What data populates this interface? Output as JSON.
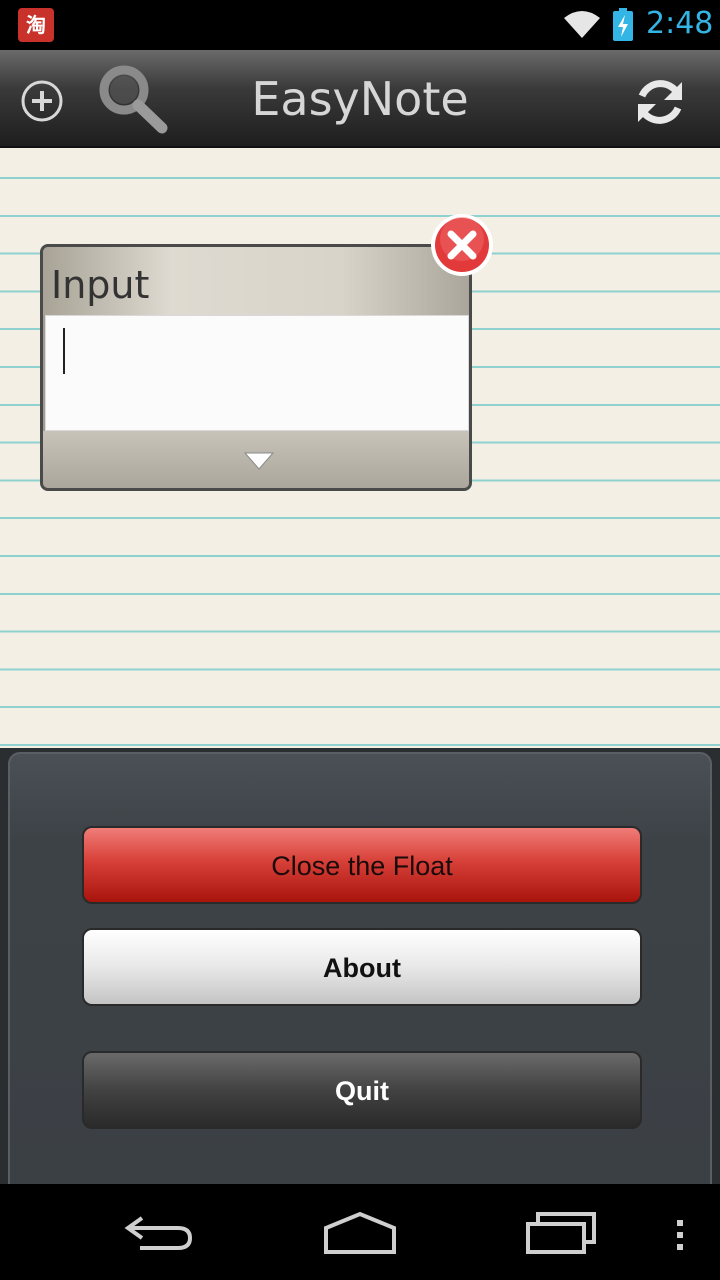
{
  "status_bar": {
    "notification_icon": "taobao-app-icon",
    "notification_glyph": "淘",
    "wifi_icon": "wifi-icon",
    "battery_icon": "battery-charging-icon",
    "time": "2:48",
    "time_color": "#33b5e5"
  },
  "action_bar": {
    "add_icon": "add-circle-icon",
    "search_icon": "search-icon",
    "title": "EasyNote",
    "refresh_icon": "refresh-icon"
  },
  "float_window": {
    "title": "Input",
    "input_value": "",
    "close_icon": "close-icon",
    "dropdown_icon": "triangle-down-icon"
  },
  "dialog": {
    "buttons": [
      {
        "label": "Close the Float",
        "color": "#d74038"
      },
      {
        "label": "About",
        "color": "#e8e8e8"
      },
      {
        "label": "Quit",
        "color": "#424242"
      }
    ]
  },
  "nav_bar": {
    "back_icon": "back-icon",
    "home_icon": "home-icon",
    "recent_icon": "recent-apps-icon",
    "menu_icon": "overflow-menu-icon"
  },
  "colors": {
    "paper": "#f4efe4",
    "paper_lines": "#8fd1cf",
    "dialog_bg": "#3d4247"
  }
}
